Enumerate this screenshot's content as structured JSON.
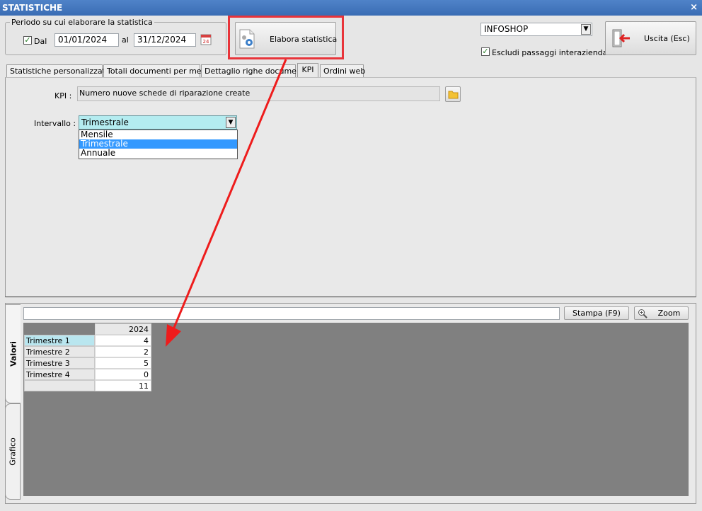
{
  "window": {
    "title": "STATISTICHE",
    "close": "×"
  },
  "period": {
    "legend": "Periodo su cui elaborare la statistica",
    "dal_label": "Dal",
    "dal_checked": true,
    "from": "01/01/2024",
    "al_label": "al",
    "to": "31/12/2024",
    "calendar_day": "24"
  },
  "elabora_button": "Elabora statistica",
  "shop_select": {
    "value": "INFOSHOP"
  },
  "escludi": {
    "label": "Escludi passaggi interaziendali",
    "checked": true
  },
  "exit_button": "Uscita (Esc)",
  "tabs": [
    {
      "label": "Statistiche personalizzate",
      "active": false
    },
    {
      "label": "Totali documenti per mese",
      "active": false
    },
    {
      "label": "Dettaglio righe documenti",
      "active": false
    },
    {
      "label": "KPI",
      "active": true
    },
    {
      "label": "Ordini web",
      "active": false
    }
  ],
  "kpi": {
    "label": "KPI :",
    "value": "Numero nuove schede di riparazione create"
  },
  "intervallo": {
    "label": "Intervallo :",
    "selected": "Trimestrale",
    "options": [
      "Mensile",
      "Trimestrale",
      "Annuale"
    ],
    "highlighted_index": 1
  },
  "results": {
    "filter_value": "",
    "print_button": "Stampa (F9)",
    "zoom_button": "Zoom",
    "side_tabs": [
      "Valori",
      "Grafico"
    ],
    "column_header": "2024",
    "rows": [
      {
        "label": "Trimestre 1",
        "value": "4"
      },
      {
        "label": "Trimestre 2",
        "value": "2"
      },
      {
        "label": "Trimestre 3",
        "value": "5"
      },
      {
        "label": "Trimestre 4",
        "value": "0"
      },
      {
        "label": "",
        "value": "11"
      }
    ]
  },
  "colors": {
    "highlight_box": "#e8343a",
    "arrow": "#ee1c1c",
    "selected_combo": "#b4ecf0",
    "dropdown_highlight": "#3399ff"
  }
}
